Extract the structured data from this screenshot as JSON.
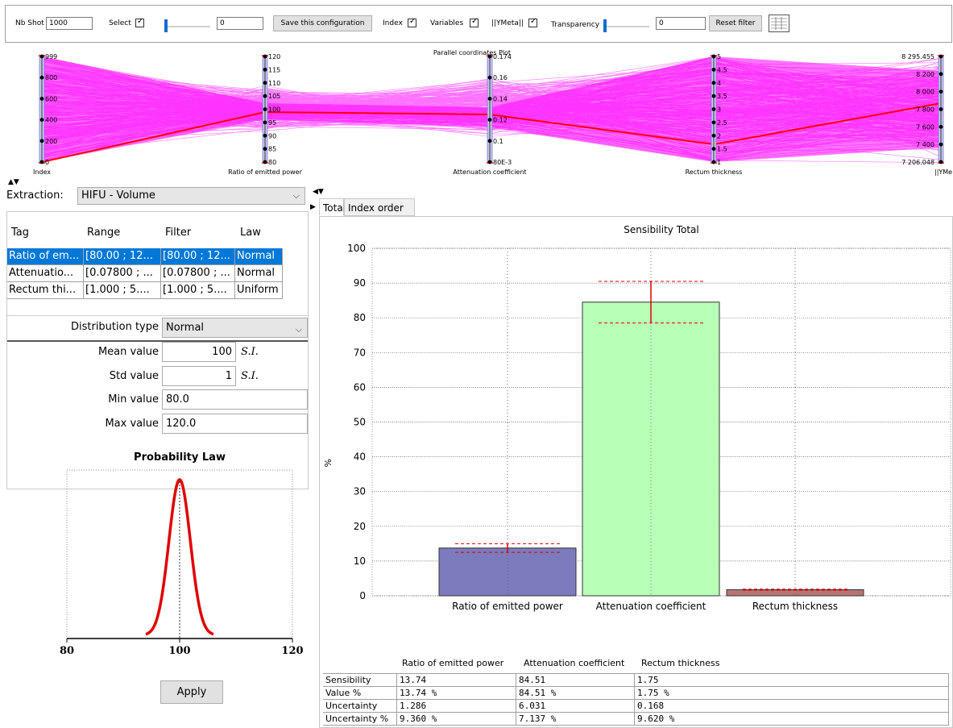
{
  "toolbar": {
    "nb_shot_label": "Nb Shot",
    "nb_shot_value": "1000",
    "select_label": "Select",
    "select_slider_value": "0",
    "save_config_label": "Save this configuration",
    "index_label": "Index",
    "variables_label": "Variables",
    "ymeta_label": "||YMeta||",
    "transparency_label": "Transparency",
    "transparency_value": "0",
    "reset_filter_label": "Reset filter"
  },
  "parallel_plot": {
    "title": "Parallel coordinates Plot",
    "line_color": "#ff00ff",
    "highlight_color": "#ff0000",
    "axes": [
      {
        "label": "Index",
        "ticks": [
          "999",
          "800",
          "600",
          "400",
          "200",
          "0"
        ]
      },
      {
        "label": "Ratio of emitted power",
        "ticks": [
          "120",
          "115",
          "110",
          "105",
          "100",
          "95",
          "90",
          "85",
          "80"
        ]
      },
      {
        "label": "Attenuation coefficient",
        "ticks": [
          "0.174",
          "0.16",
          "0.14",
          "0.12",
          "0.1",
          "80E-3"
        ]
      },
      {
        "label": "Rectum thickness",
        "ticks": [
          "5",
          "4.5",
          "4",
          "3.5",
          "3",
          "2.5",
          "2",
          "1.5",
          "1"
        ]
      },
      {
        "label": "||YMeta|",
        "ticks": [
          "8 295.455",
          "8 200",
          "8 000",
          "7 800",
          "7 600",
          "7 400",
          "7 206.048"
        ]
      }
    ]
  },
  "extraction": {
    "label": "Extraction:",
    "value": "HIFU - Volume"
  },
  "param_table": {
    "headers": [
      "Tag",
      "Range",
      "Filter",
      "Law"
    ],
    "rows": [
      [
        "Ratio of em...",
        "[80.00 ; 12...",
        "[80.00 ; 12...",
        "Normal"
      ],
      [
        "Attenuatio...",
        "[0.07800 ; ...",
        "[0.07800 ; ...",
        "Normal"
      ],
      [
        "Rectum thi...",
        "[1.000 ; 5....",
        "[1.000 ; 5....",
        "Uniform"
      ]
    ]
  },
  "distribution": {
    "type_label": "Distribution type",
    "type_value": "Normal",
    "mean_label": "Mean value",
    "mean_value": "100",
    "mean_unit": "S.I.",
    "std_label": "Std value",
    "std_value": "1",
    "std_unit": "S.I.",
    "min_label": "Min value",
    "min_value": "80.0",
    "max_label": "Max value",
    "max_value": "120.0"
  },
  "probability_law": {
    "title": "Probability Law",
    "x_ticks": [
      "80",
      "100",
      "120"
    ]
  },
  "apply_label": "Apply",
  "tabs": [
    "Total",
    "Index order 1"
  ],
  "chart_data": {
    "type": "bar",
    "title": "Sensibility Total",
    "ylabel": "%",
    "ylim": [
      0,
      100
    ],
    "yticks": [
      "0",
      "10",
      "20",
      "30",
      "40",
      "50",
      "60",
      "70",
      "80",
      "90",
      "100"
    ],
    "categories": [
      "Ratio of emitted power",
      "Attenuation coefficient",
      "Rectum thickness"
    ],
    "values": [
      13.74,
      84.51,
      1.75
    ],
    "error_low": [
      12.5,
      78.5,
      1.6
    ],
    "error_high": [
      15.0,
      90.5,
      1.9
    ],
    "colors": [
      "#7b7bbd",
      "#b8ffb8",
      "#b87474"
    ],
    "grid": true
  },
  "results_table": {
    "headers": [
      "",
      "Ratio of emitted power",
      "Attenuation coefficient",
      "Rectum thickness"
    ],
    "rows": [
      [
        "Sensibility",
        "13.74",
        "84.51",
        "1.75"
      ],
      [
        "Value %",
        "13.74 %",
        "84.51 %",
        "1.75 %"
      ],
      [
        "Uncertainty",
        "1.286",
        "6.031",
        "0.168"
      ],
      [
        "Uncertainty %",
        "9.360 %",
        "7.137 %",
        "9.620 %"
      ]
    ]
  }
}
